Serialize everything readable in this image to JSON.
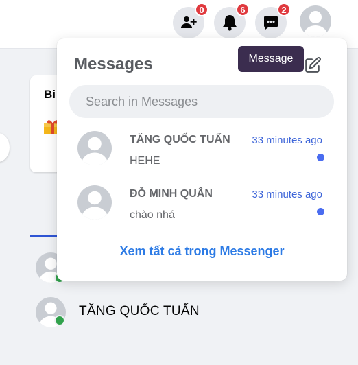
{
  "header": {
    "friend_requests_badge": "0",
    "notifications_badge": "6",
    "messages_badge": "2"
  },
  "background": {
    "card_text": "Bi",
    "contacts": [
      {
        "name": ""
      },
      {
        "name": "TĂNG QUỐC TUẤN"
      }
    ]
  },
  "messages_panel": {
    "title": "Messages",
    "search_placeholder": "Search in Messages",
    "conversations": [
      {
        "name": "TĂNG QUỐC TUẤN",
        "time": "33 minutes ago",
        "last_message": "HEHE",
        "unread": true
      },
      {
        "name": "ĐỖ MINH QUÂN",
        "time": "33 minutes ago",
        "last_message": "chào nhá",
        "unread": true
      }
    ],
    "see_all": "Xem tất cả trong Messenger"
  },
  "tooltip": {
    "text": "Message"
  },
  "colors": {
    "badge": "#e0393e",
    "link": "#2d7be5",
    "time": "#3f66d9",
    "unread_dot": "#4a6cf0",
    "online": "#31a24c",
    "tooltip_bg": "#3b2d4f"
  },
  "icons": {
    "friend_requests": "add-user-icon",
    "notifications": "bell-icon",
    "messages": "chat-bubble-icon",
    "compose": "edit-icon"
  }
}
